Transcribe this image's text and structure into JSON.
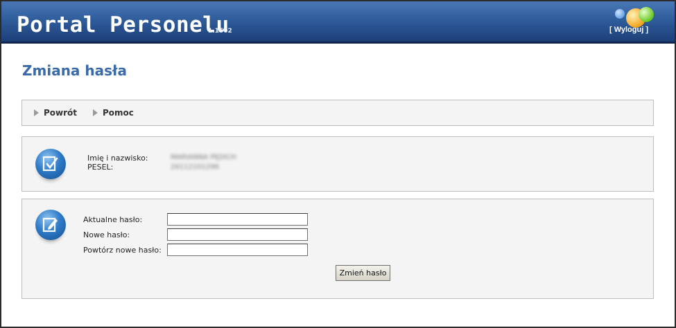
{
  "header": {
    "title": "Portal Personelu",
    "version": "1.1502",
    "logout_label": "[ Wyloguj ]"
  },
  "page": {
    "title": "Zmiana hasła"
  },
  "nav": {
    "items": [
      {
        "label": "Powrót"
      },
      {
        "label": "Pomoc"
      }
    ]
  },
  "user_info": {
    "name_label": "Imię i nazwisko:",
    "pesel_label": "PESEL:",
    "name_value": "MARIANNA PĘDICH",
    "pesel_value": "26112101296"
  },
  "password_form": {
    "current_label": "Aktualne hasło:",
    "new_label": "Nowe hasło:",
    "repeat_label": "Powtórz nowe hasło:",
    "current_value": "",
    "new_value": "",
    "repeat_value": "",
    "submit_label": "Zmień hasło"
  },
  "colors": {
    "header_top": "#4a76b4",
    "header_bottom": "#1c3f78",
    "title": "#3b6aa8",
    "panel_bg": "#f4f4f4"
  },
  "icons": {
    "user_icon": "document-check-icon",
    "form_icon": "document-edit-icon",
    "logo": "bubbles-logo"
  }
}
